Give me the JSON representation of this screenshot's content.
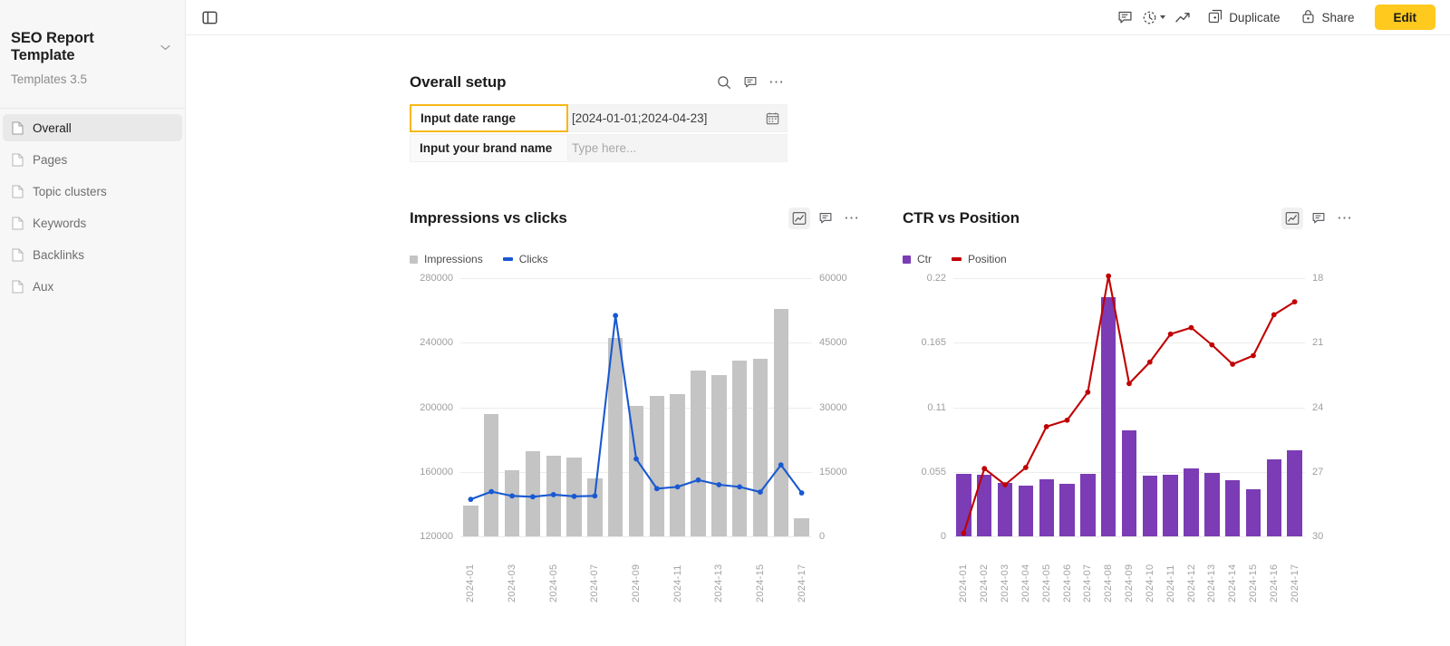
{
  "sidebar": {
    "doc_title": "SEO Report Template",
    "doc_subtitle": "Templates 3.5",
    "chevron": "∨",
    "items": [
      {
        "label": "Overall",
        "icon": "file-icon",
        "active": true
      },
      {
        "label": "Pages",
        "icon": "file-icon",
        "active": false
      },
      {
        "label": "Topic clusters",
        "icon": "file-icon",
        "active": false
      },
      {
        "label": "Keywords",
        "icon": "file-icon",
        "active": false
      },
      {
        "label": "Backlinks",
        "icon": "file-icon",
        "active": false
      },
      {
        "label": "Aux",
        "icon": "file-icon",
        "active": false
      }
    ]
  },
  "toolbar": {
    "sidebar_toggle_icon": "sidebar-toggle-icon",
    "comment_icon": "comment-icon",
    "history_icon": "history-clock-icon",
    "trend_icon": "trend-arrow-icon",
    "duplicate_label": "Duplicate",
    "duplicate_icon": "duplicate-icon",
    "share_label": "Share",
    "share_icon": "lock-icon",
    "edit_label": "Edit",
    "edit_color": "#FFC91E"
  },
  "setup": {
    "title": "Overall setup",
    "tools": {
      "search_icon": "search-icon",
      "comment_icon": "comment-icon",
      "more_icon": "more-dots-icon"
    },
    "rows": [
      {
        "key": "Input date range",
        "value": "[2024-01-01;2024-04-23]",
        "placeholder": "",
        "focused": true,
        "trailing_icon": "calendar-icon"
      },
      {
        "key": "Input your brand name",
        "value": "",
        "placeholder": "Type here...",
        "focused": false,
        "trailing_icon": ""
      }
    ]
  },
  "charts": [
    {
      "title": "Impressions vs clicks",
      "tools": {
        "chart_icon": "line-chart-icon",
        "comment_icon": "comment-icon",
        "more_icon": "more-dots-icon"
      }
    },
    {
      "title": "CTR vs Position",
      "tools": {
        "chart_icon": "line-chart-icon",
        "comment_icon": "comment-icon",
        "more_icon": "more-dots-icon"
      }
    }
  ],
  "chart_data": [
    {
      "type": "bar",
      "title": "Impressions vs clicks",
      "xlabel": "",
      "ylabel": "",
      "grid": true,
      "legend_position": "top-left",
      "x_label_step": 2,
      "categories": [
        "2024-01",
        "2024-02",
        "2024-03",
        "2024-04",
        "2024-05",
        "2024-06",
        "2024-07",
        "2024-08",
        "2024-09",
        "2024-10",
        "2024-11",
        "2024-12",
        "2024-13",
        "2024-14",
        "2024-15",
        "2024-16",
        "2024-17"
      ],
      "axes": {
        "left": {
          "name": "Impressions",
          "ticks": [
            120000,
            160000,
            200000,
            240000,
            280000
          ],
          "ylim": [
            120000,
            280000
          ]
        },
        "right": {
          "name": "Clicks",
          "ticks": [
            0,
            15000,
            30000,
            45000,
            60000
          ],
          "ylim": [
            0,
            60000
          ]
        }
      },
      "series": [
        {
          "name": "Impressions",
          "type": "bar",
          "axis": "left",
          "color": "#c4c4c4",
          "values": [
            139000,
            196000,
            161000,
            173000,
            170000,
            169000,
            156000,
            243000,
            201000,
            207000,
            208000,
            223000,
            220000,
            229000,
            230000,
            261000,
            131000
          ]
        },
        {
          "name": "Clicks",
          "type": "line",
          "axis": "right",
          "color": "#1859d1",
          "values": [
            8600,
            10400,
            9400,
            9200,
            9700,
            9300,
            9400,
            51300,
            18000,
            11100,
            11500,
            13100,
            12000,
            11500,
            10300,
            16600,
            10100
          ]
        }
      ]
    },
    {
      "type": "bar",
      "title": "CTR vs Position",
      "xlabel": "",
      "ylabel": "",
      "grid": true,
      "legend_position": "top-left",
      "x_label_step": 1,
      "categories": [
        "2024-01",
        "2024-02",
        "2024-03",
        "2024-04",
        "2024-05",
        "2024-06",
        "2024-07",
        "2024-08",
        "2024-09",
        "2024-10",
        "2024-11",
        "2024-12",
        "2024-13",
        "2024-14",
        "2024-15",
        "2024-16",
        "2024-17"
      ],
      "axes": {
        "left": {
          "name": "Ctr",
          "ticks": [
            0,
            0.055,
            0.11,
            0.165,
            0.22
          ],
          "ylim": [
            0,
            0.22
          ]
        },
        "right": {
          "name": "Position",
          "ticks": [
            18,
            21,
            24,
            27,
            30
          ],
          "ylim": [
            30,
            18
          ],
          "inverted": true
        }
      },
      "series": [
        {
          "name": "Ctr",
          "type": "bar",
          "axis": "left",
          "color": "#7B3CB5",
          "values": [
            0.0535,
            0.0525,
            0.0455,
            0.0435,
            0.049,
            0.045,
            0.0535,
            0.204,
            0.0905,
            0.052,
            0.0525,
            0.058,
            0.054,
            0.0475,
            0.0405,
            0.066,
            0.0735
          ]
        },
        {
          "name": "Position",
          "type": "line",
          "axis": "right",
          "color": "#C00000",
          "values": [
            29.85,
            26.85,
            27.6,
            26.8,
            24.9,
            24.6,
            23.3,
            17.9,
            22.9,
            21.9,
            20.6,
            20.3,
            21.1,
            22.0,
            21.6,
            19.7,
            19.1
          ]
        }
      ]
    }
  ]
}
